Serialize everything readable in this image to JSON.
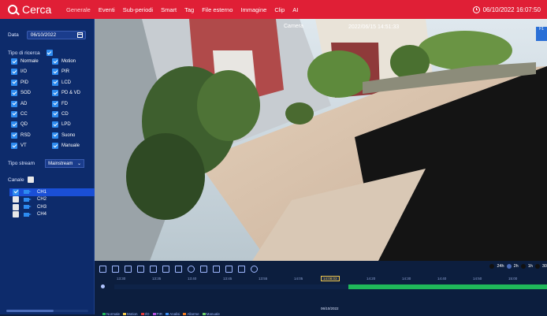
{
  "app": {
    "title": "Cerca"
  },
  "menu": [
    "Generale",
    "Eventi",
    "Sub-periodi",
    "Smart",
    "Tag",
    "File esterno",
    "Immagine",
    "Clip",
    "AI"
  ],
  "clock": "06/10/2022 16:07:50",
  "sidebar": {
    "date_label": "Data",
    "date_value": "06/10/2022",
    "type_label": "Tipo di ricerca",
    "types": [
      "Normale",
      "Motion",
      "I/O",
      "PIR",
      "PID",
      "LCD",
      "SOD",
      "PD & VD",
      "AD",
      "FD",
      "CC",
      "CD",
      "QD",
      "LPD",
      "RSD",
      "Suono",
      "VT",
      "Manuale"
    ],
    "stream_label": "Tipo stream",
    "stream_value": "Mainstream",
    "channel_label": "Canale",
    "channels": [
      "CH1",
      "CH2",
      "CH3",
      "CH4"
    ]
  },
  "video": {
    "label": "Camera",
    "timestamp": "2022/06/15 14:51:33",
    "tag": "F1"
  },
  "zoom": [
    "24h",
    "2h",
    "1h",
    "30"
  ],
  "timeline": {
    "times": [
      "13:30",
      "13:35",
      "13:40",
      "13:45",
      "13:55",
      "14:05",
      "14:10",
      "14:20",
      "14:30",
      "14:40",
      "14:50",
      "15:00",
      "15:10"
    ],
    "cursor": "14:08:03",
    "date": "06/10/2022",
    "legend": [
      {
        "label": "Normale",
        "color": "#1fb85a"
      },
      {
        "label": "Motion",
        "color": "#f2c94c"
      },
      {
        "label": "I/O",
        "color": "#e23a3a"
      },
      {
        "label": "PIR",
        "color": "#b34fe0"
      },
      {
        "label": "Analisi",
        "color": "#3a8bf0"
      },
      {
        "label": "Allarme",
        "color": "#f07a1f"
      },
      {
        "label": "Manuale",
        "color": "#6ad06a"
      }
    ]
  }
}
